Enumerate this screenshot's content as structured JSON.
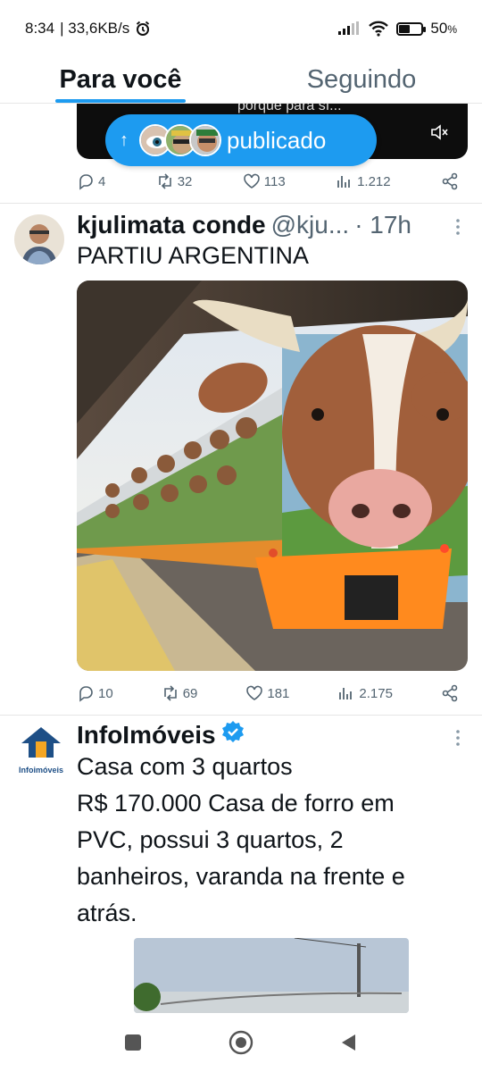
{
  "status_bar": {
    "time": "8:34",
    "network_speed": "| 33,6KB/s",
    "battery": "50",
    "battery_symbol": "%",
    "battery_level": 0.5
  },
  "tabs": [
    {
      "label": "Para você",
      "active": true
    },
    {
      "label": "Seguindo",
      "active": false
    }
  ],
  "video": {
    "caption": "porque para sí..."
  },
  "new_posts_pill": {
    "label": "publicado",
    "arrow": "↑"
  },
  "posts": [
    {
      "stats": {
        "replies": "4",
        "reposts": "32",
        "likes": "113",
        "views": "1.212"
      }
    },
    {
      "author": "kjulimata conde",
      "handle": "@kju...",
      "time": "· 17h",
      "text": "PARTIU ARGENTINA",
      "stats": {
        "replies": "10",
        "reposts": "69",
        "likes": "181",
        "views": "2.175"
      }
    },
    {
      "author": "InfoImóveis",
      "avatar_text": "Infoimóveis",
      "text_lines": [
        "Casa com 3 quartos",
        "R$ 170.000 Casa de forro em",
        "PVC, possui 3 quartos, 2",
        "banheiros, varanda na frente e",
        "atrás."
      ]
    }
  ],
  "icons": {
    "reply": "reply-icon",
    "repost": "repost-icon",
    "like": "like-icon",
    "views": "views-icon",
    "share": "share-icon",
    "verified": "verified-icon"
  },
  "colors": {
    "accent": "#1d9bf0",
    "text": "#0f1419",
    "secondary": "#536471"
  }
}
